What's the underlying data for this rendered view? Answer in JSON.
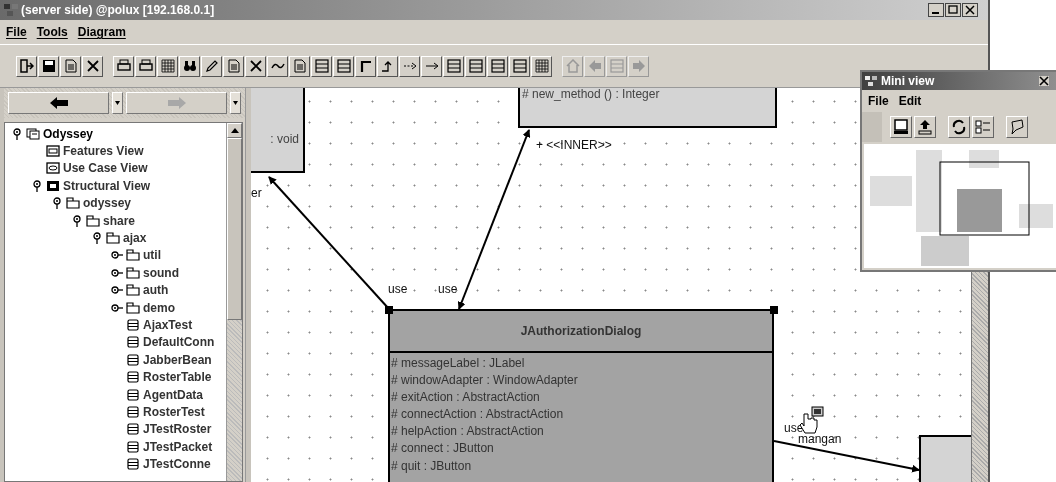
{
  "window": {
    "title": "(server side) @polux [192.168.0.1]"
  },
  "menu": [
    "File",
    "Tools",
    "Diagram"
  ],
  "toolbar": [
    [
      {
        "disabled": false
      },
      {
        "disabled": false
      },
      {
        "disabled": false
      },
      {
        "disabled": false
      }
    ],
    [
      {
        "disabled": false
      },
      {
        "disabled": false
      },
      {
        "disabled": false
      },
      {
        "disabled": false
      },
      {
        "disabled": false
      },
      {
        "disabled": false
      },
      {
        "disabled": false
      },
      {
        "disabled": false
      },
      {
        "disabled": false
      },
      {
        "disabled": false
      },
      {
        "disabled": false
      },
      {
        "disabled": false
      },
      {
        "disabled": false
      },
      {
        "disabled": false
      },
      {
        "disabled": false
      },
      {
        "disabled": false
      },
      {
        "disabled": false
      },
      {
        "disabled": false
      },
      {
        "disabled": false
      },
      {
        "disabled": false
      }
    ],
    [
      {
        "disabled": true
      },
      {
        "disabled": true
      },
      {
        "disabled": true
      },
      {
        "disabled": true
      }
    ]
  ],
  "navigator": {
    "back_disabled": false,
    "forward_disabled": true
  },
  "tree": [
    {
      "label": "Odyssey",
      "kind": "model",
      "expanded": true,
      "children": [
        {
          "label": "Features View",
          "kind": "features"
        },
        {
          "label": "Use Case View",
          "kind": "usecase"
        },
        {
          "label": "Structural View",
          "kind": "structural",
          "expanded": true,
          "children": [
            {
              "label": "odyssey",
              "kind": "package",
              "expanded": true,
              "children": [
                {
                  "label": "share",
                  "kind": "package",
                  "expanded": true,
                  "children": [
                    {
                      "label": "ajax",
                      "kind": "package",
                      "expanded": true,
                      "children": [
                        {
                          "label": "util",
                          "kind": "package",
                          "expanded": false
                        },
                        {
                          "label": "sound",
                          "kind": "package",
                          "expanded": false
                        },
                        {
                          "label": "auth",
                          "kind": "package",
                          "expanded": false
                        },
                        {
                          "label": "demo",
                          "kind": "package",
                          "expanded": false
                        },
                        {
                          "label": "AjaxTest",
                          "kind": "class"
                        },
                        {
                          "label": "DefaultConn",
                          "kind": "class"
                        },
                        {
                          "label": "JabberBean",
                          "kind": "class"
                        },
                        {
                          "label": "RosterTable",
                          "kind": "class"
                        },
                        {
                          "label": "AgentData",
                          "kind": "class"
                        },
                        {
                          "label": "RosterTest",
                          "kind": "class"
                        },
                        {
                          "label": "JTestRoster",
                          "kind": "class"
                        },
                        {
                          "label": "JTestPacket",
                          "kind": "class"
                        },
                        {
                          "label": "JTestConne",
                          "kind": "class"
                        }
                      ]
                    }
                  ]
                }
              ]
            }
          ]
        }
      ]
    }
  ],
  "diagram": {
    "partial_classes": [
      {
        "text": ": void"
      },
      {
        "text": "# new_method () : Integer"
      }
    ],
    "labels": [
      {
        "text": "er"
      },
      {
        "text": "+  <<INNER>>"
      },
      {
        "text": "use"
      },
      {
        "text": "use"
      },
      {
        "text": "use"
      },
      {
        "text": "mangan"
      }
    ],
    "class": {
      "name": "JAuthorizationDialog",
      "selected": true,
      "attributes": [
        "# messageLabel : JLabel",
        "# windowAdapter : WindowAdapter",
        "# exitAction : AbstractAction",
        "# connectAction : AbstractAction",
        "# helpAction : AbstractAction",
        "# connect : JButton",
        "# quit : JButton"
      ]
    }
  },
  "mini_view": {
    "title": "Mini view",
    "menu": [
      "File",
      "Edit"
    ]
  }
}
